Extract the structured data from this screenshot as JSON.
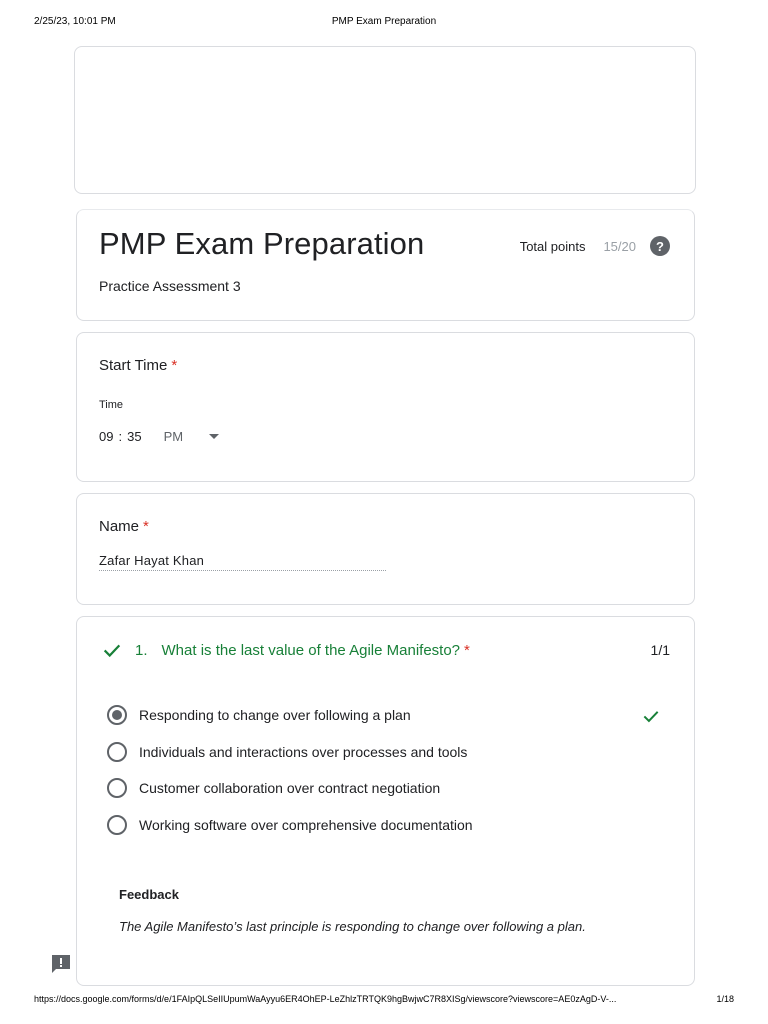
{
  "print_header": {
    "datetime": "2/25/23, 10:01 PM",
    "document_title": "PMP Exam Preparation"
  },
  "form": {
    "title": "PMP Exam Preparation",
    "description": "Practice Assessment 3",
    "total_points_label": "Total points",
    "total_points_score": "15/20",
    "help_icon": "help-icon"
  },
  "start_time": {
    "label": "Start Time",
    "required_mark": "*",
    "time_label": "Time",
    "hour": "09",
    "separator": ":",
    "minute": "35",
    "ampm": "PM"
  },
  "name": {
    "label": "Name",
    "required_mark": "*",
    "answer": "Zafar Hayat Khan"
  },
  "question_1": {
    "number": "1.",
    "text": "What is the last value of the Agile Manifesto?",
    "required_mark": "*",
    "score": "1/1",
    "options": [
      {
        "label": "Responding to change over following a plan",
        "selected": true,
        "correct": true
      },
      {
        "label": "Individuals and interactions over processes and tools",
        "selected": false,
        "correct": false
      },
      {
        "label": "Customer collaboration over contract negotiation",
        "selected": false,
        "correct": false
      },
      {
        "label": "Working software over comprehensive documentation",
        "selected": false,
        "correct": false
      }
    ],
    "feedback_label": "Feedback",
    "feedback_text": "The Agile Manifesto’s last principle is responding to change over following a plan."
  },
  "print_footer": {
    "url": "https://docs.google.com/forms/d/e/1FAIpQLSeIIUpumWaAyyu6ER4OhEP-LeZhlzTRTQK9hgBwjwC7R8XISg/viewscore?viewscore=AE0zAgD-V-...",
    "page": "1/18"
  },
  "colors": {
    "correct_green": "#188038",
    "required_red": "#d93025",
    "border": "#dadce0",
    "icon_gray": "#5f6368"
  }
}
